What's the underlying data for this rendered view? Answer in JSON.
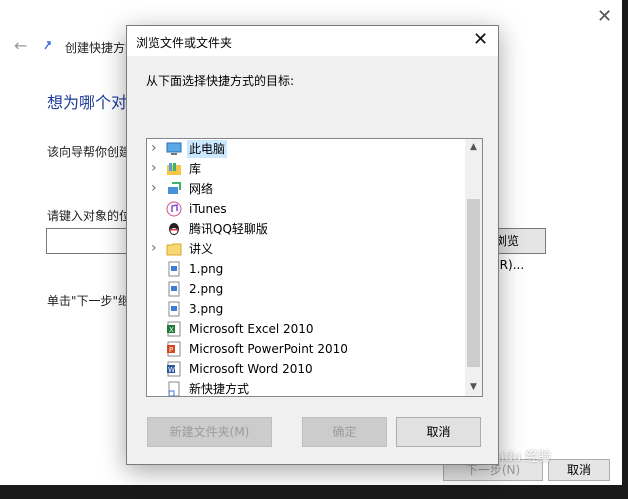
{
  "wizard": {
    "title": "创建快捷方式",
    "heading": "想为哪个对",
    "description": "该向导帮你创建",
    "prompt": "请键入对象的位",
    "location_value": "",
    "browse_label": "浏览(R)...",
    "continue_hint": "单击\"下一步\"继",
    "next_label": "下一步(N)",
    "cancel_label": "取消",
    "close_glyph": "✕",
    "back_glyph": "←"
  },
  "dialog": {
    "title": "浏览文件或文件夹",
    "close_glyph": "✕",
    "instruction": "从下面选择快捷方式的目标:",
    "items": [
      {
        "label": "此电脑",
        "icon": "computer-icon",
        "expandable": true,
        "selected": true
      },
      {
        "label": "库",
        "icon": "library-icon",
        "expandable": true,
        "selected": false
      },
      {
        "label": "网络",
        "icon": "network-icon",
        "expandable": true,
        "selected": false
      },
      {
        "label": "iTunes",
        "icon": "itunes-icon",
        "expandable": false,
        "selected": false
      },
      {
        "label": "腾讯QQ轻聊版",
        "icon": "qq-icon",
        "expandable": false,
        "selected": false
      },
      {
        "label": "讲义",
        "icon": "folder-icon",
        "expandable": true,
        "selected": false
      },
      {
        "label": "1.png",
        "icon": "image-file-icon",
        "expandable": false,
        "selected": false
      },
      {
        "label": "2.png",
        "icon": "image-file-icon",
        "expandable": false,
        "selected": false
      },
      {
        "label": "3.png",
        "icon": "image-file-icon",
        "expandable": false,
        "selected": false
      },
      {
        "label": "Microsoft Excel 2010",
        "icon": "excel-icon",
        "expandable": false,
        "selected": false
      },
      {
        "label": "Microsoft PowerPoint 2010",
        "icon": "powerpoint-icon",
        "expandable": false,
        "selected": false
      },
      {
        "label": "Microsoft Word 2010",
        "icon": "word-icon",
        "expandable": false,
        "selected": false
      },
      {
        "label": "新快捷方式",
        "icon": "shortcut-file-icon",
        "expandable": false,
        "selected": false
      }
    ],
    "new_folder_label": "新建文件夹(M)",
    "ok_label": "确定",
    "cancel_label": "取消"
  },
  "watermark": "Baidu 经验",
  "colors": {
    "heading": "#1f3d99",
    "selection": "#cce8ff",
    "disabled_text": "#9c9c9c"
  }
}
